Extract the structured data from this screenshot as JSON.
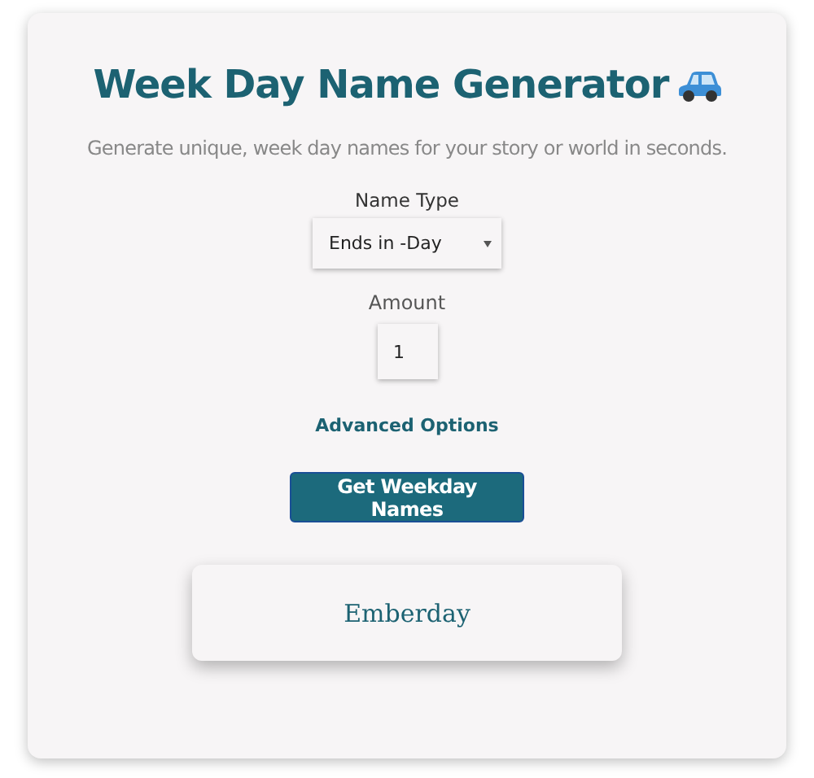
{
  "title": "Week Day Name Generator",
  "subtitle": "Generate unique, week day names for your story or world in seconds.",
  "name_type": {
    "label": "Name Type",
    "value": "Ends in -Day"
  },
  "amount": {
    "label": "Amount",
    "value": "1"
  },
  "advanced_options": "Advanced Options",
  "button": "Get Weekday Names",
  "results": [
    "Emberday"
  ]
}
